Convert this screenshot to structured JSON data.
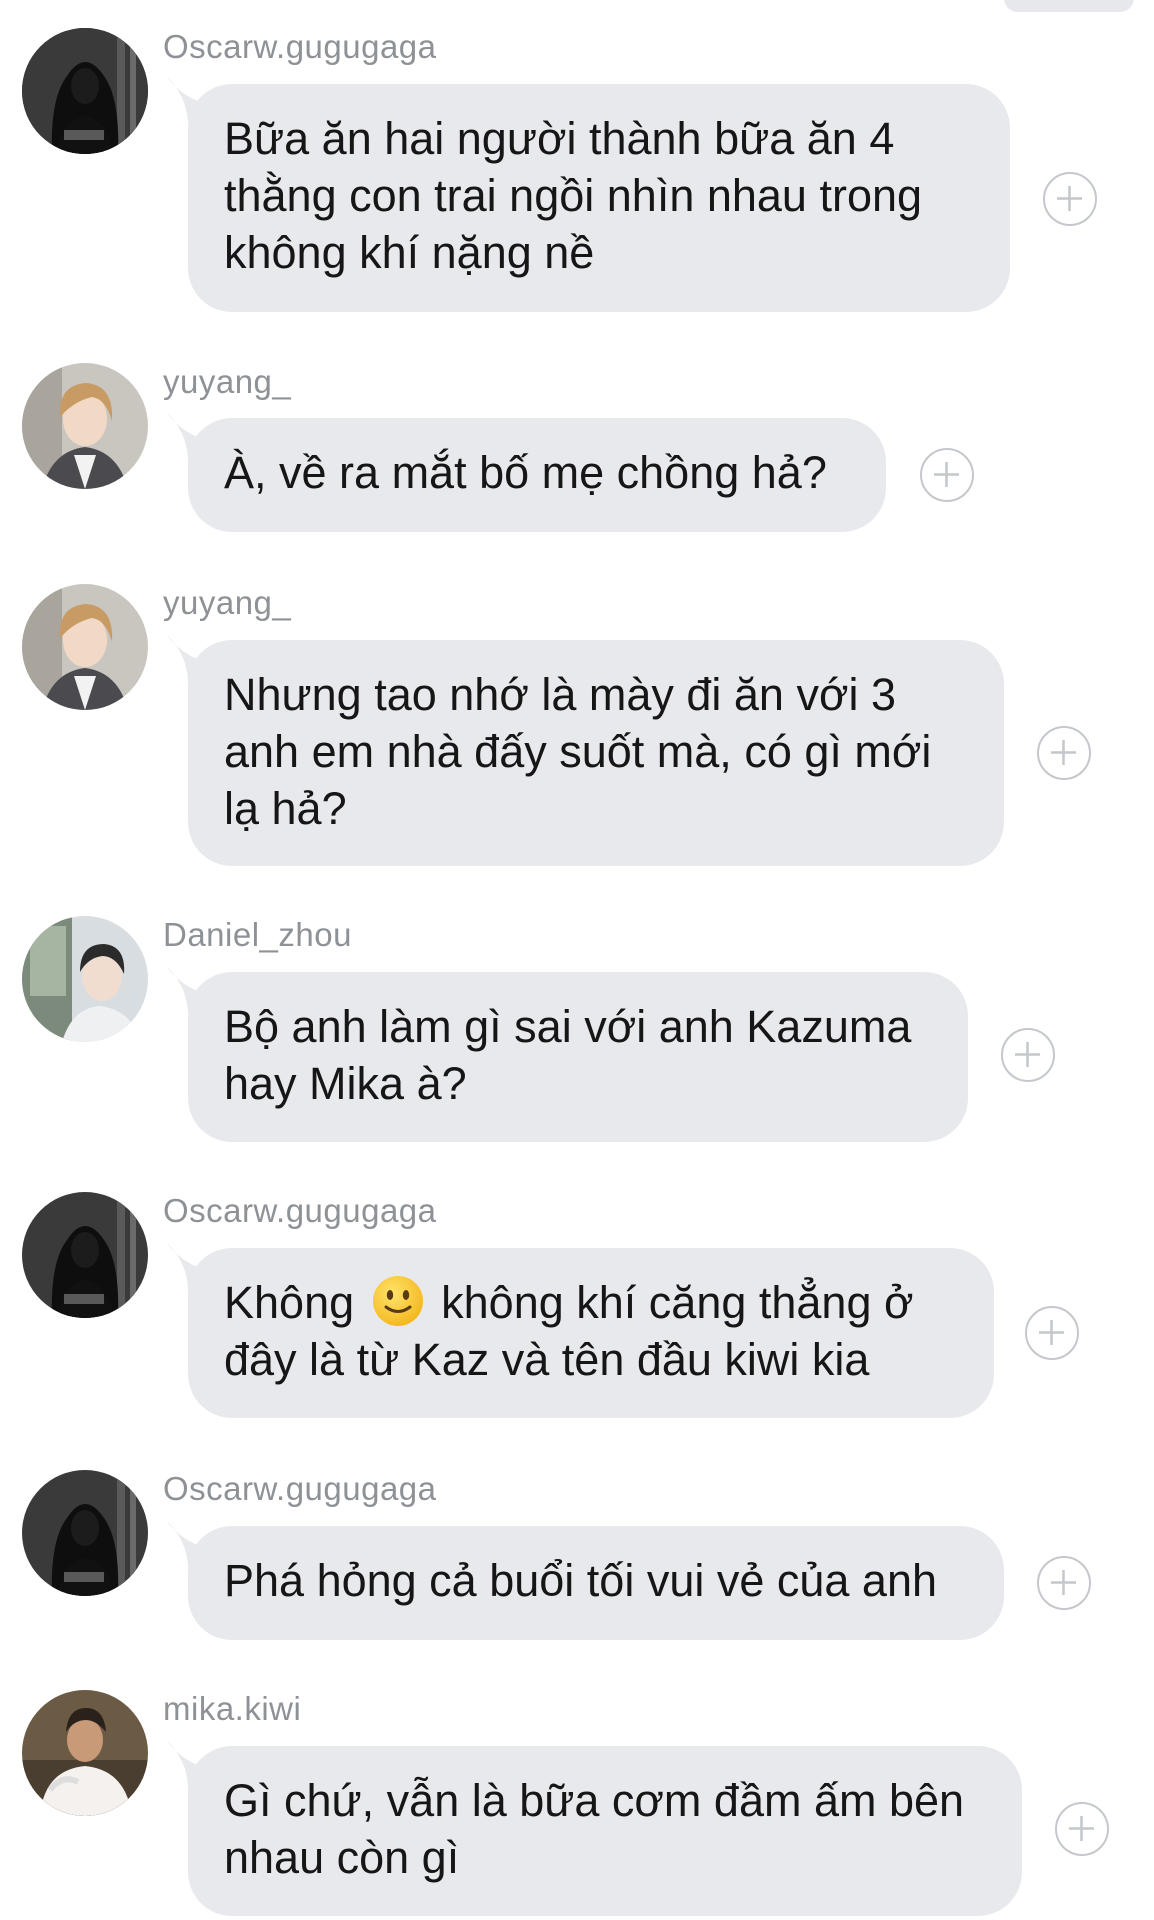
{
  "messages": [
    {
      "sender": "Oscarw.gugugaga",
      "avatar": "hooded-dark-avatar",
      "lines": [
        "Bữa ăn hai người thành bữa ăn 4",
        "thằng con trai ngồi nhìn nhau trong",
        "không khí nặng nề"
      ]
    },
    {
      "sender": "yuyang_",
      "avatar": "blond-hair-avatar",
      "lines": [
        "À, về ra mắt bố mẹ chồng hả?"
      ]
    },
    {
      "sender": "yuyang_",
      "avatar": "blond-hair-avatar",
      "lines": [
        "Nhưng tao nhớ là mày đi ăn với 3",
        "anh em nhà đấy suốt mà, có gì mới",
        "lạ hả?"
      ]
    },
    {
      "sender": "Daniel_zhou",
      "avatar": "window-seat-avatar",
      "lines": [
        "Bộ anh làm gì sai với anh Kazuma",
        "hay Mika à?"
      ]
    },
    {
      "sender": "Oscarw.gugugaga",
      "avatar": "hooded-dark-avatar",
      "lines": [
        "Không",
        "không khí căng thẳng ở",
        "đây là từ Kaz và tên đầu kiwi kia"
      ],
      "emoji": "slightly-smiling-face-emoji"
    },
    {
      "sender": "Oscarw.gugugaga",
      "avatar": "hooded-dark-avatar",
      "lines": [
        "Phá hỏng cả buổi tối vui vẻ của anh"
      ]
    },
    {
      "sender": "mika.kiwi",
      "avatar": "white-hoodie-avatar",
      "lines": [
        "Gì chứ, vẫn là bữa cơm đầm ấm bên",
        "nhau còn gì"
      ]
    }
  ],
  "icons": {
    "add_reaction": "plus-circle-icon"
  },
  "colors": {
    "bubble": "#e8e9ed",
    "sender_text": "#8e9297",
    "message_text": "#161616",
    "add_icon": "#c4c7cc"
  }
}
